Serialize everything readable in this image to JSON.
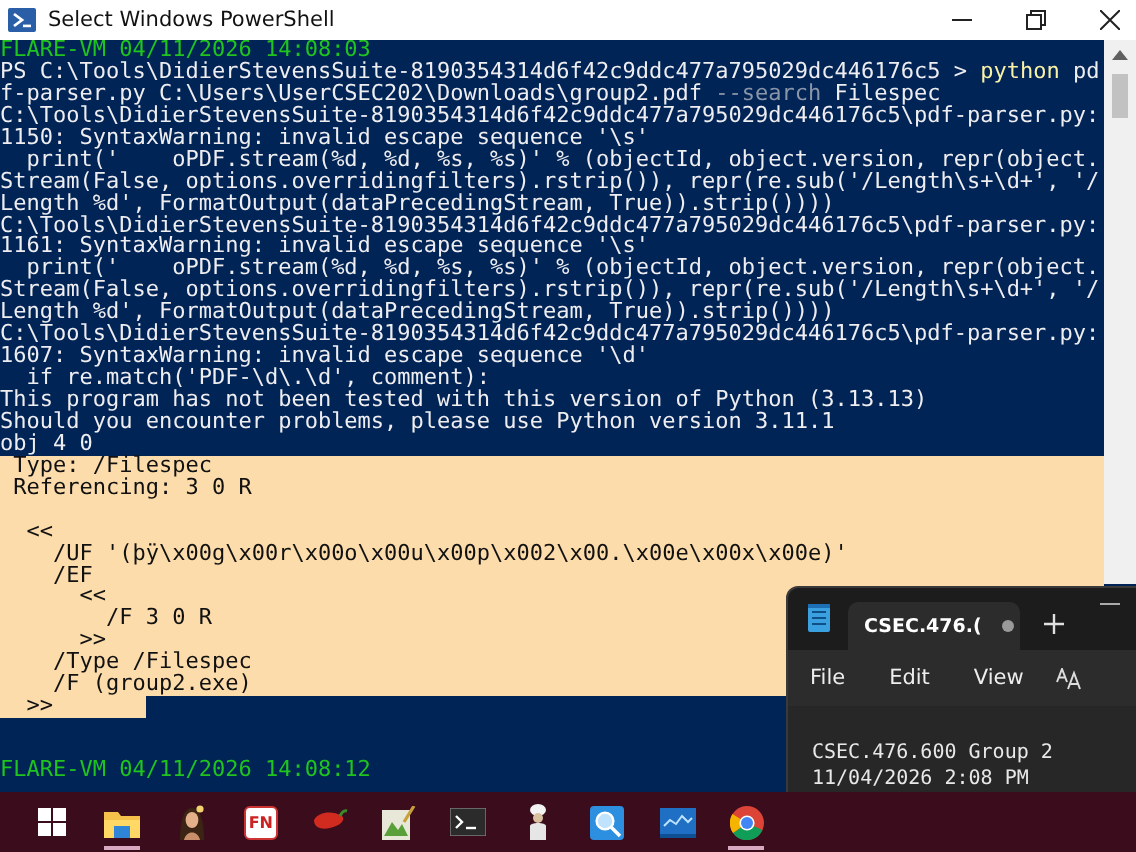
{
  "window": {
    "title": "Select Windows PowerShell"
  },
  "console": {
    "lines": [
      {
        "kind": "timestamp",
        "text": "FLARE-VM 04/11/2026 14:08:03",
        "selected": false
      },
      {
        "kind": "input",
        "selected": false,
        "segments": [
          {
            "kind": "plain",
            "text": "PS C:\\Tools\\DidierStevensSuite-8190354314d6f42c9ddc477a795029dc446176c5 > "
          },
          {
            "kind": "command",
            "text": "python"
          },
          {
            "kind": "plain",
            "text": " pd"
          }
        ]
      },
      {
        "kind": "input",
        "selected": false,
        "segments": [
          {
            "kind": "plain",
            "text": "f-parser.py C:\\Users\\UserCSEC202\\Downloads\\group2.pdf "
          },
          {
            "kind": "parameter",
            "text": "--search"
          },
          {
            "kind": "plain",
            "text": " Filespec"
          }
        ]
      },
      {
        "kind": "output",
        "text": "C:\\Tools\\DidierStevensSuite-8190354314d6f42c9ddc477a795029dc446176c5\\pdf-parser.py:",
        "selected": false
      },
      {
        "kind": "output",
        "text": "1150: SyntaxWarning: invalid escape sequence '\\s'",
        "selected": false
      },
      {
        "kind": "output",
        "text": "  print('    oPDF.stream(%d, %d, %s, %s)' % (objectId, object.version, repr(object.",
        "selected": false
      },
      {
        "kind": "output",
        "text": "Stream(False, options.overridingfilters).rstrip()), repr(re.sub('/Length\\s+\\d+', '/",
        "selected": false
      },
      {
        "kind": "output",
        "text": "Length %d', FormatOutput(dataPrecedingStream, True)).strip())))",
        "selected": false
      },
      {
        "kind": "output",
        "text": "C:\\Tools\\DidierStevensSuite-8190354314d6f42c9ddc477a795029dc446176c5\\pdf-parser.py:",
        "selected": false
      },
      {
        "kind": "output",
        "text": "1161: SyntaxWarning: invalid escape sequence '\\s'",
        "selected": false
      },
      {
        "kind": "output",
        "text": "  print('    oPDF.stream(%d, %d, %s, %s)' % (objectId, object.version, repr(object.",
        "selected": false
      },
      {
        "kind": "output",
        "text": "Stream(False, options.overridingfilters).rstrip()), repr(re.sub('/Length\\s+\\d+', '/",
        "selected": false
      },
      {
        "kind": "output",
        "text": "Length %d', FormatOutput(dataPrecedingStream, True)).strip())))",
        "selected": false
      },
      {
        "kind": "output",
        "text": "C:\\Tools\\DidierStevensSuite-8190354314d6f42c9ddc477a795029dc446176c5\\pdf-parser.py:",
        "selected": false
      },
      {
        "kind": "output",
        "text": "1607: SyntaxWarning: invalid escape sequence '\\d'",
        "selected": false
      },
      {
        "kind": "output",
        "text": "  if re.match('PDF-\\d\\.\\d', comment):",
        "selected": false
      },
      {
        "kind": "output",
        "text": "This program has not been tested with this version of Python (3.13.13)",
        "selected": false
      },
      {
        "kind": "output",
        "text": "Should you encounter problems, please use Python version 3.11.1",
        "selected": false
      },
      {
        "kind": "output",
        "text": "obj 4 0",
        "selected": false
      },
      {
        "kind": "output",
        "text": " Type: /Filespec",
        "selected": true
      },
      {
        "kind": "output",
        "text": " Referencing: 3 0 R",
        "selected": true
      },
      {
        "kind": "blank",
        "selected": true
      },
      {
        "kind": "output",
        "text": "  <<",
        "selected": true
      },
      {
        "kind": "output",
        "text": "    /UF '(þÿ\\x00g\\x00r\\x00o\\x00u\\x00p\\x002\\x00.\\x00e\\x00x\\x00e)'",
        "selected": true
      },
      {
        "kind": "output",
        "text": "    /EF",
        "selected": true
      },
      {
        "kind": "output",
        "text": "      <<",
        "selected": true
      },
      {
        "kind": "output",
        "text": "        /F 3 0 R",
        "selected": true
      },
      {
        "kind": "output",
        "text": "      >>",
        "selected": true
      },
      {
        "kind": "output",
        "text": "    /Type /Filespec",
        "selected": true
      },
      {
        "kind": "output",
        "text": "    /F (group2.exe)",
        "selected": true
      },
      {
        "kind": "output",
        "text": "  >>",
        "selected": true
      },
      {
        "kind": "timestamp",
        "text": "FLARE-VM 04/11/2026 14:08:12",
        "selected": false
      }
    ]
  },
  "notepad": {
    "tab": {
      "title": "CSEC.476.(",
      "selected": true,
      "modified": true
    },
    "menu": [
      "File",
      "Edit",
      "View"
    ],
    "content": [
      "CSEC.476.600 Group 2",
      "11/04/2026 2:08 PM"
    ]
  },
  "taskbar": {
    "items": [
      {
        "kind": "start",
        "running": false
      },
      {
        "kind": "folder",
        "running": true
      },
      {
        "kind": "portrait",
        "running": false
      },
      {
        "kind": "fn",
        "label": "FN",
        "running": false
      },
      {
        "kind": "pepper",
        "running": false
      },
      {
        "kind": "image",
        "running": false
      },
      {
        "kind": "terminal",
        "running": false
      },
      {
        "kind": "figure",
        "running": false
      },
      {
        "kind": "magnifier",
        "running": false
      },
      {
        "kind": "monitor",
        "running": false
      },
      {
        "kind": "globe",
        "running": true
      }
    ]
  }
}
